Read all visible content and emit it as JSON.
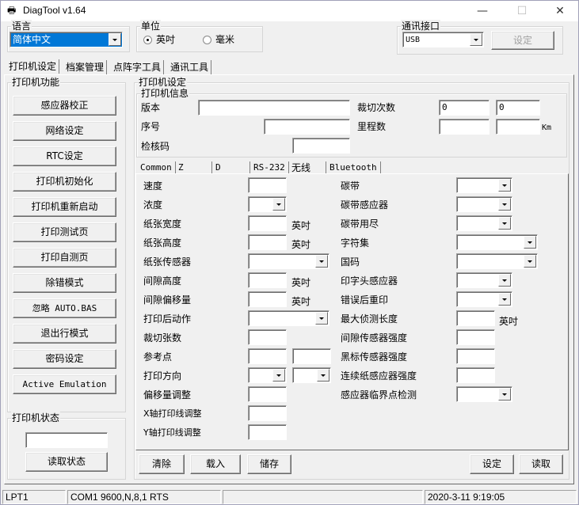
{
  "window": {
    "title": "DiagTool v1.64",
    "app_icon": "printer-icon",
    "controls": {
      "minimize": "—",
      "maximize": "☐",
      "close": "✕"
    }
  },
  "language": {
    "group_label": "语言",
    "selected": "简体中文"
  },
  "unit": {
    "group_label": "单位",
    "options": [
      {
        "label": "英吋",
        "selected": true
      },
      {
        "label": "毫米",
        "selected": false
      }
    ]
  },
  "comm": {
    "group_label": "通讯接口",
    "selected": "USB",
    "set_button": "设定"
  },
  "main_tabs": [
    {
      "label": "打印机设定",
      "active": true
    },
    {
      "label": "档案管理",
      "active": false
    },
    {
      "label": "点阵字工具",
      "active": false
    },
    {
      "label": "通讯工具",
      "active": false
    }
  ],
  "printer_functions": {
    "group_label": "打印机功能",
    "buttons": [
      "感应器校正",
      "网络设定",
      "RTC设定",
      "打印机初始化",
      "打印机重新启动",
      "打印测试页",
      "打印自测页",
      "除错模式",
      "忽略 AUTO.BAS",
      "退出行模式",
      "密码设定",
      "Active Emulation"
    ]
  },
  "printer_status": {
    "group_label": "打印机状态",
    "value": "",
    "read_button": "读取状态"
  },
  "printer_settings": {
    "group_label": "打印机设定",
    "info": {
      "group_label": "打印机信息",
      "version_label": "版本",
      "version_value": "",
      "serial_label": "序号",
      "serial_value": "",
      "checksum_label": "检核码",
      "checksum_value": "",
      "cut_count_label": "裁切次数",
      "cut_count_values": [
        "0",
        "0"
      ],
      "mileage_label": "里程数",
      "mileage_values": [
        "",
        ""
      ],
      "mileage_unit": "Km"
    },
    "sub_tabs": [
      {
        "label": "Common",
        "active": true
      },
      {
        "label": "Z",
        "active": false
      },
      {
        "label": "D",
        "active": false
      },
      {
        "label": "RS-232",
        "active": false
      },
      {
        "label": "无线",
        "active": false
      },
      {
        "label": "Bluetooth",
        "active": false
      }
    ],
    "left_fields": {
      "speed": "速度",
      "density": "浓度",
      "paper_width": "纸张宽度",
      "paper_height": "纸张高度",
      "paper_sensor": "纸张传感器",
      "gap_height": "间隙高度",
      "gap_offset": "间隙偏移量",
      "post_print_action": "打印后动作",
      "cut_pieces": "裁切张数",
      "reference": "参考点",
      "direction": "打印方向",
      "offset_adjust": "偏移量调整",
      "x_line_adjust": "X轴打印线调整",
      "y_line_adjust": "Y轴打印线调整"
    },
    "right_fields": {
      "ribbon": "碳带",
      "ribbon_sensor": "碳带感应器",
      "ribbon_end": "碳带用尽",
      "charset": "字符集",
      "country_code": "国码",
      "head_sensor": "印字头感应器",
      "reprint_after_error": "错误后重印",
      "max_detect_length": "最大侦测长度",
      "gap_sensor_intensity": "间隙传感器强度",
      "bline_sensor_intensity": "黑标传感器强度",
      "continuous_sensor_intensity": "连续纸感应器强度",
      "sensor_threshold_detect": "感应器临界点检测"
    },
    "unit_inch": "英吋",
    "buttons": {
      "clear": "清除",
      "load": "载入",
      "save": "储存",
      "set": "设定",
      "read": "读取"
    }
  },
  "statusbar": {
    "port": "LPT1",
    "com": "COM1 9600,N,8,1 RTS",
    "middle": "",
    "datetime": "2020-3-11 9:19:05"
  }
}
